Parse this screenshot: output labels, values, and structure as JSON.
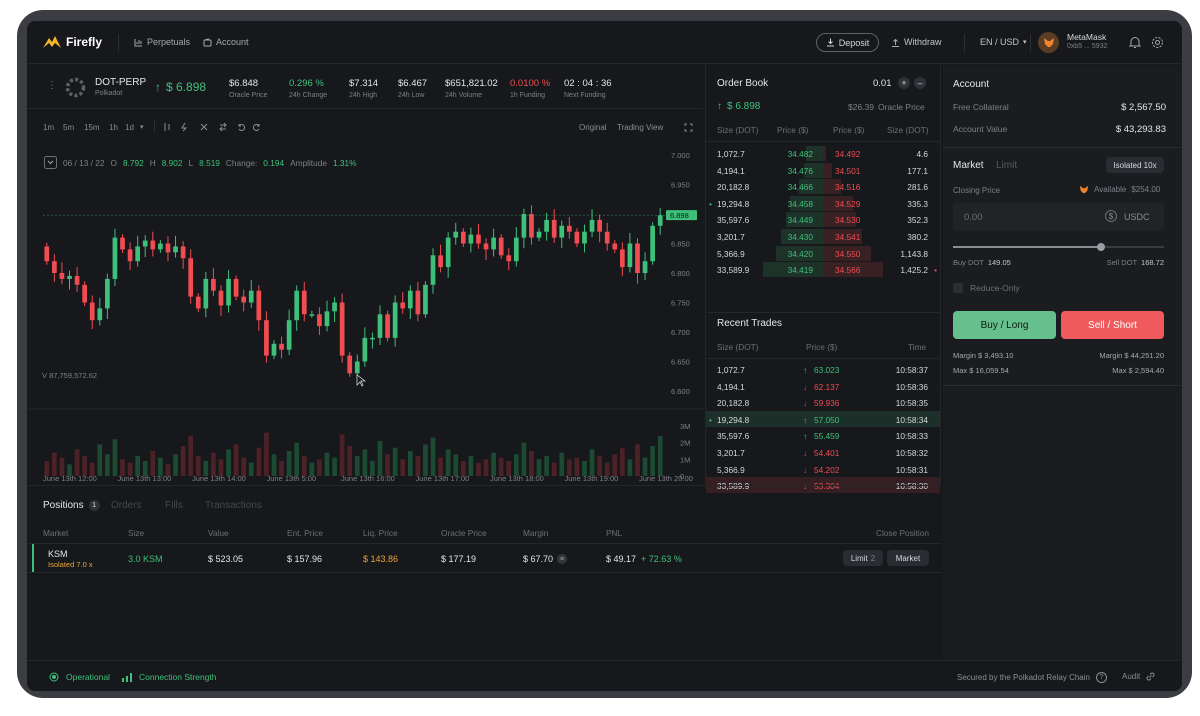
{
  "app": {
    "name": "Firefly"
  },
  "nav": {
    "perpetuals": "Perpetuals",
    "account": "Account"
  },
  "top_right": {
    "deposit": "Deposit",
    "withdraw": "Withdraw",
    "locale": "EN / USD",
    "wallet_name": "MetaMask",
    "wallet_addr": "0xb5 ... 5932"
  },
  "market": {
    "pair": "DOT-PERP",
    "network": "Polkadot",
    "price": "$ 6.898",
    "stats": [
      {
        "value": "$6.848",
        "label": "Oracle Price",
        "color": "default"
      },
      {
        "value": "0.296 %",
        "label": "24h Change",
        "color": "green"
      },
      {
        "value": "$7.314",
        "label": "24h High",
        "color": "default"
      },
      {
        "value": "$6.467",
        "label": "24h Low",
        "color": "default"
      },
      {
        "value": "$651,821.02",
        "label": "24h Volume",
        "color": "default"
      },
      {
        "value": "0.0100 %",
        "label": "1h Funding",
        "color": "red"
      },
      {
        "value": "02 : 04 : 36",
        "label": "Next Funding",
        "color": "default"
      }
    ]
  },
  "chart_toolbar": {
    "timeframes": [
      "1m",
      "5m",
      "15m",
      "1h",
      "1d"
    ],
    "views": [
      "Original",
      "Trading View"
    ]
  },
  "chart_data": {
    "type": "candlestick",
    "ohlc_info": {
      "date": "06 / 13 / 22",
      "o_label": "O",
      "o": "8.792",
      "h_label": "H",
      "h": "8.902",
      "l_label": "L",
      "l": "8.519",
      "change_label": "Change:",
      "change": "0.194",
      "amplitude_label": "Amplitude",
      "amplitude": "1.31%"
    },
    "volume_label": "V  87,759,572.62",
    "current_price_tag": "6.898",
    "price_ticks": [
      "7.000",
      "6.950",
      "6.900",
      "6.850",
      "6.800",
      "6.750",
      "6.700",
      "6.650",
      "6.600"
    ],
    "volume_ticks": [
      "3M",
      "2M",
      "1M",
      "0"
    ],
    "time_ticks": [
      "June 13th 12:00",
      "June 13th 13:00",
      "June 13th 14:00",
      "June 13th 5:00",
      "June 13th 16:00",
      "June 13th 17:00",
      "June 13th 18:00",
      "June 13th 19:00",
      "June 13th 20:00"
    ],
    "ylim": [
      6.6,
      7.0
    ],
    "candles": [
      [
        6.845,
        6.82
      ],
      [
        6.82,
        6.8
      ],
      [
        6.8,
        6.79
      ],
      [
        6.79,
        6.795
      ],
      [
        6.795,
        6.78
      ],
      [
        6.78,
        6.75
      ],
      [
        6.75,
        6.72
      ],
      [
        6.72,
        6.74
      ],
      [
        6.74,
        6.79
      ],
      [
        6.79,
        6.86
      ],
      [
        6.86,
        6.84
      ],
      [
        6.84,
        6.82
      ],
      [
        6.82,
        6.845
      ],
      [
        6.845,
        6.855
      ],
      [
        6.855,
        6.84
      ],
      [
        6.84,
        6.85
      ],
      [
        6.85,
        6.835
      ],
      [
        6.835,
        6.845
      ],
      [
        6.845,
        6.825
      ],
      [
        6.825,
        6.76
      ],
      [
        6.76,
        6.74
      ],
      [
        6.74,
        6.79
      ],
      [
        6.79,
        6.77
      ],
      [
        6.77,
        6.745
      ],
      [
        6.745,
        6.79
      ],
      [
        6.79,
        6.76
      ],
      [
        6.76,
        6.75
      ],
      [
        6.75,
        6.77
      ],
      [
        6.77,
        6.72
      ],
      [
        6.72,
        6.66
      ],
      [
        6.66,
        6.68
      ],
      [
        6.68,
        6.67
      ],
      [
        6.67,
        6.72
      ],
      [
        6.72,
        6.77
      ],
      [
        6.77,
        6.73
      ],
      [
        6.73,
        6.73
      ],
      [
        6.73,
        6.71
      ],
      [
        6.71,
        6.735
      ],
      [
        6.735,
        6.75
      ],
      [
        6.75,
        6.66
      ],
      [
        6.66,
        6.63
      ],
      [
        6.63,
        6.65
      ],
      [
        6.65,
        6.69
      ],
      [
        6.69,
        6.69
      ],
      [
        6.69,
        6.73
      ],
      [
        6.73,
        6.69
      ],
      [
        6.69,
        6.75
      ],
      [
        6.75,
        6.74
      ],
      [
        6.74,
        6.77
      ],
      [
        6.77,
        6.73
      ],
      [
        6.73,
        6.78
      ],
      [
        6.78,
        6.83
      ],
      [
        6.83,
        6.81
      ],
      [
        6.81,
        6.86
      ],
      [
        6.86,
        6.87
      ],
      [
        6.87,
        6.85
      ],
      [
        6.85,
        6.865
      ],
      [
        6.865,
        6.85
      ],
      [
        6.85,
        6.84
      ],
      [
        6.84,
        6.86
      ],
      [
        6.86,
        6.83
      ],
      [
        6.83,
        6.82
      ],
      [
        6.82,
        6.86
      ],
      [
        6.86,
        6.9
      ],
      [
        6.9,
        6.86
      ],
      [
        6.86,
        6.87
      ],
      [
        6.87,
        6.89
      ],
      [
        6.89,
        6.86
      ],
      [
        6.86,
        6.88
      ],
      [
        6.88,
        6.87
      ],
      [
        6.87,
        6.85
      ],
      [
        6.85,
        6.87
      ],
      [
        6.87,
        6.89
      ],
      [
        6.89,
        6.87
      ],
      [
        6.87,
        6.85
      ],
      [
        6.85,
        6.84
      ],
      [
        6.84,
        6.81
      ],
      [
        6.81,
        6.85
      ],
      [
        6.85,
        6.8
      ],
      [
        6.8,
        6.82
      ],
      [
        6.82,
        6.88
      ],
      [
        6.88,
        6.898
      ]
    ],
    "volumes": [
      0.9,
      1.4,
      1.1,
      0.7,
      1.6,
      1.2,
      0.8,
      1.9,
      1.3,
      2.2,
      1.0,
      0.8,
      1.2,
      0.9,
      1.5,
      1.1,
      0.7,
      1.3,
      1.8,
      2.4,
      1.2,
      0.9,
      1.4,
      1.0,
      1.6,
      1.9,
      1.1,
      0.8,
      1.7,
      2.6,
      1.3,
      0.9,
      1.5,
      2.0,
      1.2,
      0.8,
      1.0,
      1.4,
      1.1,
      2.5,
      1.8,
      1.2,
      1.6,
      0.9,
      2.1,
      1.3,
      1.7,
      1.0,
      1.5,
      1.2,
      1.9,
      2.3,
      1.1,
      1.6,
      1.3,
      0.9,
      1.2,
      0.8,
      1.0,
      1.4,
      1.1,
      0.9,
      1.3,
      2.0,
      1.5,
      1.0,
      1.2,
      0.8,
      1.4,
      1.0,
      1.1,
      0.9,
      1.6,
      1.2,
      0.8,
      1.3,
      1.7,
      1.0,
      1.9,
      1.1,
      1.8,
      2.4
    ]
  },
  "order_book": {
    "title": "Order Book",
    "step": "0.01",
    "last_price": "$ 6.898",
    "oracle_price": "$26.39",
    "oracle_label": "Oracle Price",
    "headers": [
      "Size (DOT)",
      "Price ($)",
      "Price ($)",
      "Size (DOT)"
    ],
    "rows": [
      {
        "bsize": "1,072.7",
        "bprice": "34.482",
        "aprice": "34.492",
        "asize": "4.6",
        "bdepth": 0.28,
        "adepth": 0.05
      },
      {
        "bsize": "4,194.1",
        "bprice": "34.476",
        "aprice": "34.501",
        "asize": "177.1",
        "bdepth": 0.32,
        "adepth": 0.15
      },
      {
        "bsize": "20,182.8",
        "bprice": "34.466",
        "aprice": "34.516",
        "asize": "281.6",
        "bdepth": 0.4,
        "adepth": 0.3
      },
      {
        "bsize": "19,294.8",
        "bprice": "34.458",
        "aprice": "34.529",
        "asize": "335.3",
        "bdepth": 0.55,
        "adepth": 0.5,
        "dot": true
      },
      {
        "bsize": "35,597.6",
        "bprice": "34.449",
        "aprice": "34.530",
        "asize": "352.3",
        "bdepth": 0.62,
        "adepth": 0.55
      },
      {
        "bsize": "3,201.7",
        "bprice": "34.430",
        "aprice": "34.541",
        "asize": "380.2",
        "bdepth": 0.7,
        "adepth": 0.65
      },
      {
        "bsize": "5,366.9",
        "bprice": "34.420",
        "aprice": "34.550",
        "asize": "1,143.8",
        "bdepth": 0.78,
        "adepth": 0.8
      },
      {
        "bsize": "33,589.9",
        "bprice": "34.419",
        "aprice": "34.566",
        "asize": "1,425.2",
        "bdepth": 1.0,
        "adepth": 1.0,
        "adot": true
      }
    ]
  },
  "recent_trades": {
    "title": "Recent Trades",
    "headers": [
      "Size (DOT)",
      "Price ($)",
      "Time"
    ],
    "rows": [
      {
        "size": "1,072.7",
        "price": "63.023",
        "dir": "up",
        "time": "10:58:37"
      },
      {
        "size": "4,194.1",
        "price": "62.137",
        "dir": "down",
        "time": "10:58:36"
      },
      {
        "size": "20,182.8",
        "price": "59.936",
        "dir": "down",
        "time": "10:58:35"
      },
      {
        "size": "19,294.8",
        "price": "57.050",
        "dir": "up",
        "time": "10:58:34",
        "hl": "green",
        "dot": true
      },
      {
        "size": "35,597.6",
        "price": "55.459",
        "dir": "up",
        "time": "10:58:33"
      },
      {
        "size": "3,201.7",
        "price": "54.401",
        "dir": "down",
        "time": "10:58:32"
      },
      {
        "size": "5,366.9",
        "price": "54.202",
        "dir": "down",
        "time": "10:58:31"
      },
      {
        "size": "33,589.9",
        "price": "53.304",
        "dir": "down",
        "time": "10:58:30",
        "hl": "red"
      }
    ]
  },
  "account": {
    "title": "Account",
    "free_collateral_label": "Free Collateral",
    "free_collateral": "$ 2,567.50",
    "account_value_label": "Account Value",
    "account_value": "$ 43,293.83"
  },
  "order_form": {
    "tab_market": "Market",
    "tab_limit": "Limit",
    "margin_mode": "Isolated 10x",
    "closing_price_label": "Closing Price",
    "available_label": "Available",
    "available": "$254.00",
    "amount_placeholder": "0.00",
    "currency": "USDC",
    "buy_dot_label": "Buy DOT",
    "buy_dot": "149.05",
    "sell_dot_label": "Sell DOT",
    "sell_dot": "168.72",
    "reduce_only": "Reduce-Only",
    "buy_button": "Buy / Long",
    "sell_button": "Sell / Short",
    "margin_buy": "Margin  $ 3,493.10",
    "margin_sell": "Margin  $ 44,251.20",
    "max_buy": "Max  $ 16,059.54",
    "max_sell": "Max  $ 2,594.40",
    "slider_value": 0.7
  },
  "positions": {
    "tabs": [
      "Positions",
      "Orders",
      "Fills",
      "Transactions"
    ],
    "count": "1",
    "headers": [
      "Market",
      "Size",
      "Value",
      "Ent. Price",
      "Liq. Price",
      "Oracle Price",
      "Margin",
      "PNL",
      "Close Position"
    ],
    "row": {
      "market": "KSM",
      "mode": "Isolated 7.0 x",
      "size": "3.0  KSM",
      "value": "$ 523.05",
      "entry": "$ 157.96",
      "liq": "$ 143.86",
      "oracle": "$ 177.19",
      "margin": "$ 67.70",
      "pnl": "$ 49.17",
      "pnl_pct": "+ 72.63 %",
      "limit_btn": "Limit",
      "limit_count": "2",
      "market_btn": "Market"
    }
  },
  "status": {
    "operational": "Operational",
    "connection": "Connection Strength",
    "secured": "Secured by the Polkadot Relay Chain",
    "audit": "Audit"
  },
  "colors": {
    "green": "#3ec07a",
    "red": "#ef4d52",
    "bg": "#17181b",
    "panel": "#1c1d21"
  }
}
